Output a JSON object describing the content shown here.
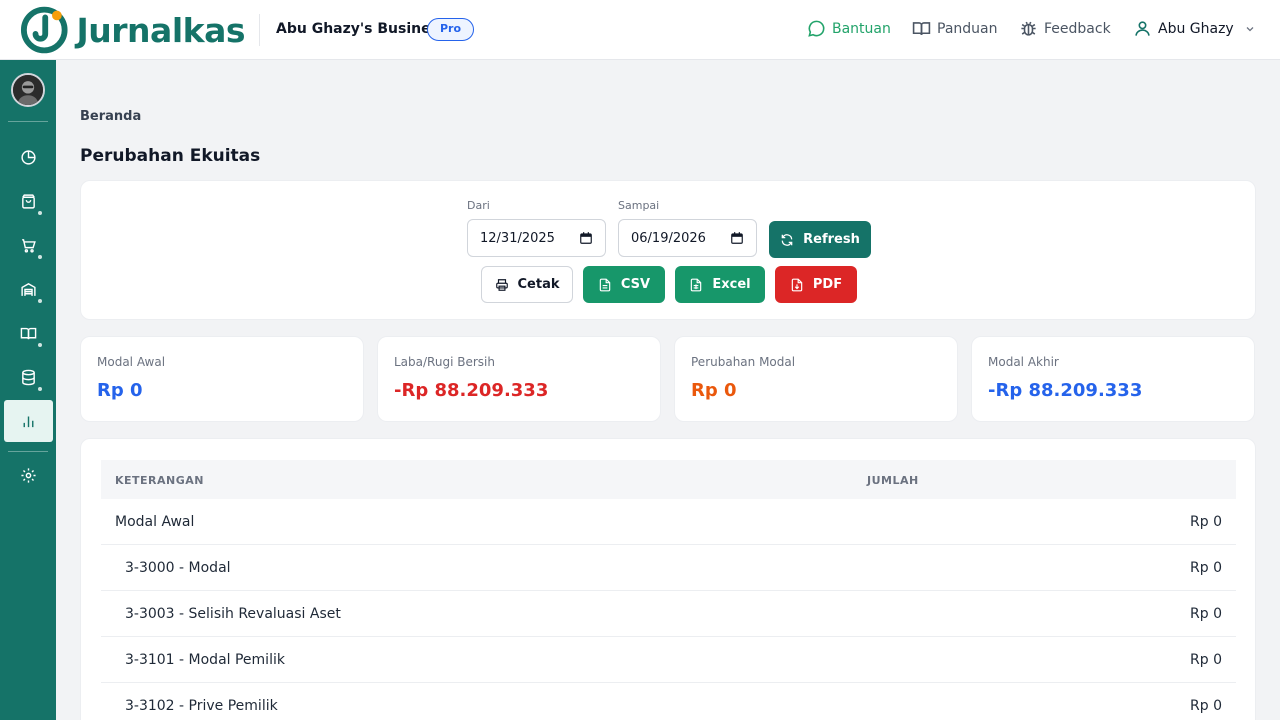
{
  "app": {
    "name": "Jurnalkas",
    "business_name": "Abu Ghazy's Business",
    "plan_badge": "Pro"
  },
  "top_nav": {
    "help": "Bantuan",
    "guide": "Panduan",
    "feedback": "Feedback",
    "user": "Abu Ghazy"
  },
  "sidebar": {
    "items": [
      {
        "icon": "pie-chart-icon"
      },
      {
        "icon": "shopping-bag-icon"
      },
      {
        "icon": "cart-icon"
      },
      {
        "icon": "warehouse-icon"
      },
      {
        "icon": "book-icon"
      },
      {
        "icon": "database-icon"
      },
      {
        "icon": "bar-chart-icon",
        "active": true
      },
      {
        "icon": "gear-icon"
      }
    ]
  },
  "breadcrumb": "Beranda",
  "page_title": "Perubahan Ekuitas",
  "filter": {
    "from_label": "Dari",
    "from_value": "12/31/2025",
    "to_label": "Sampai",
    "to_value": "06/19/2026",
    "refresh_label": "Refresh",
    "print_label": "Cetak",
    "csv_label": "CSV",
    "excel_label": "Excel",
    "pdf_label": "PDF"
  },
  "stats": [
    {
      "label": "Modal Awal",
      "value": "Rp 0",
      "color": "#2563eb"
    },
    {
      "label": "Laba/Rugi Bersih",
      "value": "-Rp 88.209.333",
      "color": "#dc2626"
    },
    {
      "label": "Perubahan Modal",
      "value": "Rp 0",
      "color": "#ea580c"
    },
    {
      "label": "Modal Akhir",
      "value": "-Rp 88.209.333",
      "color": "#2563eb"
    }
  ],
  "table": {
    "headers": {
      "description": "KETERANGAN",
      "amount": "JUMLAH"
    },
    "rows": [
      {
        "description": "Modal Awal",
        "amount": "Rp 0",
        "indent": false
      },
      {
        "description": "3-3000 - Modal",
        "amount": "Rp 0",
        "indent": true
      },
      {
        "description": "3-3003 - Selisih Revaluasi Aset",
        "amount": "Rp 0",
        "indent": true
      },
      {
        "description": "3-3101 - Modal Pemilik",
        "amount": "Rp 0",
        "indent": true
      },
      {
        "description": "3-3102 - Prive Pemilik",
        "amount": "Rp 0",
        "indent": true
      }
    ]
  },
  "colors": {
    "brand": "#157368",
    "help_link": "#22a36a",
    "badge": "#2563eb",
    "export_green": "#17976a",
    "export_red": "#dc2626"
  }
}
